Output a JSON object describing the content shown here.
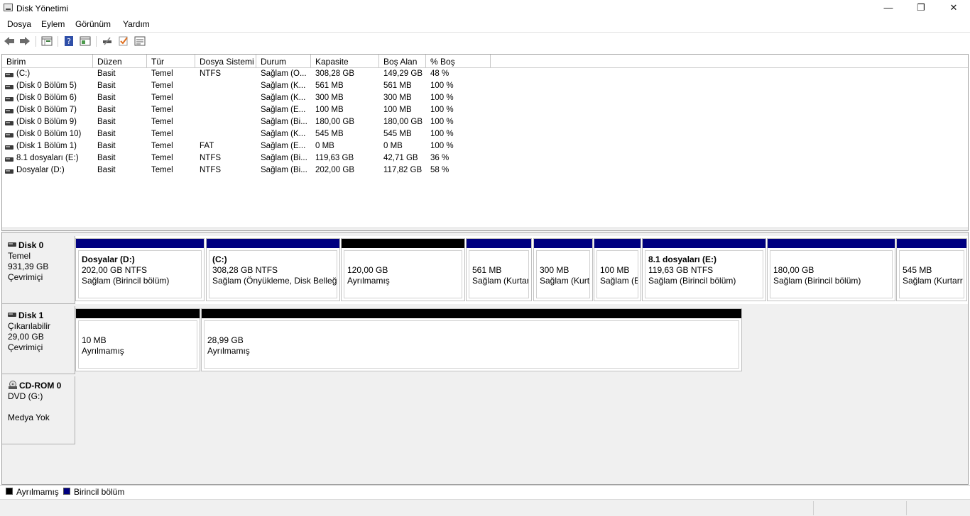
{
  "window": {
    "title": "Disk Yönetimi",
    "minimize": "—",
    "restore": "❐",
    "close": "✕"
  },
  "menu": [
    "Dosya",
    "Eylem",
    "Görünüm",
    "Yardım"
  ],
  "toolbar": {
    "icons": [
      "back-arrow-icon",
      "forward-arrow-icon",
      "disk-list-icon",
      "help-icon",
      "action-pane-icon",
      "connect-icon",
      "check-icon",
      "properties-icon"
    ]
  },
  "volumes": {
    "columns": [
      "Birim",
      "Düzen",
      "Tür",
      "Dosya Sistemi",
      "Durum",
      "Kapasite",
      "Boş Alan",
      "% Boş"
    ],
    "rows": [
      [
        " (C:)",
        "Basit",
        "Temel",
        "NTFS",
        "Sağlam (Ö...",
        "308,28 GB",
        "149,29 GB",
        "48 %"
      ],
      [
        "(Disk 0 Bölüm 5)",
        "Basit",
        "Temel",
        "",
        "Sağlam (K...",
        "561 MB",
        "561 MB",
        "100 %"
      ],
      [
        "(Disk 0 Bölüm 6)",
        "Basit",
        "Temel",
        "",
        "Sağlam (K...",
        "300 MB",
        "300 MB",
        "100 %"
      ],
      [
        "(Disk 0 Bölüm 7)",
        "Basit",
        "Temel",
        "",
        "Sağlam (E...",
        "100 MB",
        "100 MB",
        "100 %"
      ],
      [
        "(Disk 0 Bölüm 9)",
        "Basit",
        "Temel",
        "",
        "Sağlam (Bi...",
        "180,00 GB",
        "180,00 GB",
        "100 %"
      ],
      [
        "(Disk 0 Bölüm 10)",
        "Basit",
        "Temel",
        "",
        "Sağlam (K...",
        "545 MB",
        "545 MB",
        "100 %"
      ],
      [
        "(Disk 1 Bölüm 1)",
        "Basit",
        "Temel",
        "FAT",
        "Sağlam (E...",
        "0 MB",
        "0 MB",
        "100 %"
      ],
      [
        "8.1 dosyaları (E:)",
        "Basit",
        "Temel",
        "NTFS",
        "Sağlam (Bi...",
        "119,63 GB",
        "42,71 GB",
        "36 %"
      ],
      [
        "Dosyalar (D:)",
        "Basit",
        "Temel",
        "NTFS",
        "Sağlam (Bi...",
        "202,00 GB",
        "117,82 GB",
        "58 %"
      ]
    ]
  },
  "disks": [
    {
      "name": "Disk 0",
      "type": "Temel",
      "size": "931,39 GB",
      "status": "Çevrimiçi",
      "partitions": [
        {
          "title": "Dosyalar  (D:)",
          "line1": "202,00 GB NTFS",
          "line2": "Sağlam (Birincil bölüm)",
          "kind": "primary"
        },
        {
          "title": "(C:)",
          "line1": "308,28 GB NTFS",
          "line2": "Sağlam (Önyükleme, Disk Belleği",
          "kind": "primary"
        },
        {
          "title": "",
          "line1": "120,00 GB",
          "line2": "Ayrılmamış",
          "kind": "unallocated"
        },
        {
          "title": "",
          "line1": "561 MB",
          "line2": "Sağlam (Kurtar",
          "kind": "primary"
        },
        {
          "title": "",
          "line1": "300 MB",
          "line2": "Sağlam (Kurt",
          "kind": "primary"
        },
        {
          "title": "",
          "line1": "100 MB",
          "line2": "Sağlam (E",
          "kind": "primary"
        },
        {
          "title": "8.1 dosyaları  (E:)",
          "line1": "119,63 GB NTFS",
          "line2": "Sağlam (Birincil bölüm)",
          "kind": "primary"
        },
        {
          "title": "",
          "line1": "180,00 GB",
          "line2": "Sağlam (Birincil bölüm)",
          "kind": "primary"
        },
        {
          "title": "",
          "line1": "545 MB",
          "line2": "Sağlam (Kurtarr",
          "kind": "primary"
        }
      ]
    },
    {
      "name": "Disk 1",
      "type": "Çıkarılabilir",
      "size": "29,00 GB",
      "status": "Çevrimiçi",
      "partitions": [
        {
          "title": "",
          "line1": "10 MB",
          "line2": "Ayrılmamış",
          "kind": "unallocated"
        },
        {
          "title": "",
          "line1": "28,99 GB",
          "line2": "Ayrılmamış",
          "kind": "unallocated"
        }
      ]
    },
    {
      "name": "CD-ROM 0",
      "type": "DVD (G:)",
      "size": "",
      "status": "Medya Yok",
      "partitions": []
    }
  ],
  "legend": [
    {
      "label": "Ayrılmamış",
      "color": "#000000"
    },
    {
      "label": "Birincil bölüm",
      "color": "#000080"
    }
  ],
  "colors": {
    "primary": "#000080",
    "unallocated": "#000000"
  }
}
